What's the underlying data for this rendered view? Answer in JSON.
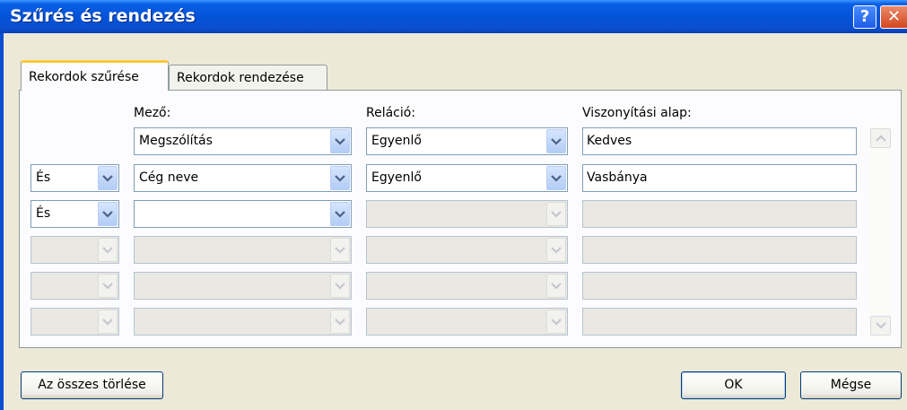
{
  "window": {
    "title": "Szűrés és rendezés",
    "help_label": "?",
    "close_label": "✕"
  },
  "tabs": [
    {
      "label": "Rekordok szűrése",
      "active": true
    },
    {
      "label": "Rekordok rendezése",
      "active": false
    }
  ],
  "columns": {
    "field": "Mező:",
    "relation": "Reláció:",
    "compare": "Viszonyítási alap:"
  },
  "rows": [
    {
      "conj": "",
      "field": "Megszólítás",
      "relation": "Egyenlő",
      "compare": "Kedves"
    },
    {
      "conj": "És",
      "field": "Cég neve",
      "relation": "Egyenlő",
      "compare": "Vasbánya"
    },
    {
      "conj": "És",
      "field": "",
      "relation": "",
      "compare": ""
    },
    {
      "conj": "",
      "field": "",
      "relation": "",
      "compare": ""
    },
    {
      "conj": "",
      "field": "",
      "relation": "",
      "compare": ""
    },
    {
      "conj": "",
      "field": "",
      "relation": "",
      "compare": ""
    }
  ],
  "buttons": {
    "clear_all": "Az összes törlése",
    "ok": "OK",
    "cancel": "Mégse"
  },
  "colors": {
    "title_bar": "#0453d8",
    "dialog_bg": "#ece9d8",
    "active_tab_accent": "#ffc83c",
    "dropdown_arrow": "#4d6185"
  },
  "icons": {
    "dropdown": "chevron-down-icon",
    "scroll_up": "chevron-up-icon",
    "scroll_down": "chevron-down-icon"
  }
}
